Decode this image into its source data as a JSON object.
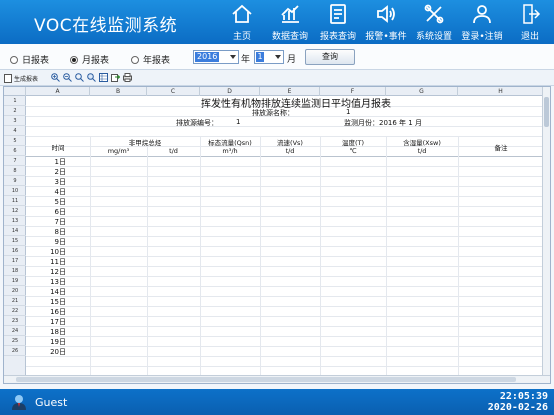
{
  "app": {
    "title": "VOC在线监测系统"
  },
  "nav": [
    {
      "label": "主页",
      "icon": "home-icon"
    },
    {
      "label": "数据查询",
      "icon": "chart-icon"
    },
    {
      "label": "报表查询",
      "icon": "report-icon"
    },
    {
      "label": "报警•事件",
      "icon": "speaker-icon"
    },
    {
      "label": "系统设置",
      "icon": "tools-icon"
    },
    {
      "label": "登录•注销",
      "icon": "user-icon"
    },
    {
      "label": "退出",
      "icon": "exit-icon"
    }
  ],
  "controls": {
    "report_types": [
      {
        "label": "日报表",
        "selected": false
      },
      {
        "label": "月报表",
        "selected": true
      },
      {
        "label": "年报表",
        "selected": false
      }
    ],
    "year_value": "2016",
    "year_unit": "年",
    "month_value": "1",
    "month_unit": "月",
    "query_label": "查询"
  },
  "toolbar": {
    "generate_label": "生成报表"
  },
  "sheet": {
    "columns": [
      "A",
      "B",
      "C",
      "D",
      "E",
      "F",
      "G",
      "H"
    ],
    "rows": [
      "1",
      "2",
      "3",
      "4",
      "5",
      "6",
      "7",
      "8",
      "9",
      "10",
      "11",
      "12",
      "13",
      "14",
      "15",
      "16",
      "17",
      "18",
      "19",
      "20",
      "21",
      "22",
      "23",
      "24",
      "25",
      "26"
    ],
    "title": "挥发性有机物排放连续监测日平均值月报表",
    "source_name_label": "排放源名称：",
    "source_name_value": "1",
    "source_no_label": "排放源编号：",
    "source_no_value": "1",
    "month_label": "监测月份：2016 年 1 月",
    "headers": {
      "time": "时间",
      "nmhc": "非甲烷总烃",
      "nmhc_unit1": "mg/m³",
      "nmhc_unit2": "t/d",
      "flow_std": "标态流量(Qsn)",
      "flow_std_unit": "m³/h",
      "velocity": "流速(Vs)",
      "velocity_unit": "t/d",
      "temp": "温度(T)",
      "temp_unit": "℃",
      "humidity": "含湿量(Xsw)",
      "humidity_unit": "t/d",
      "remark": "备注"
    },
    "days": [
      "1日",
      "2日",
      "3日",
      "4日",
      "5日",
      "6日",
      "7日",
      "8日",
      "9日",
      "10日",
      "11日",
      "12日",
      "13日",
      "14日",
      "15日",
      "16日",
      "17日",
      "18日",
      "19日",
      "20日"
    ]
  },
  "status": {
    "user": "Guest",
    "time": "22:05:39",
    "date": "2020-02-26"
  }
}
